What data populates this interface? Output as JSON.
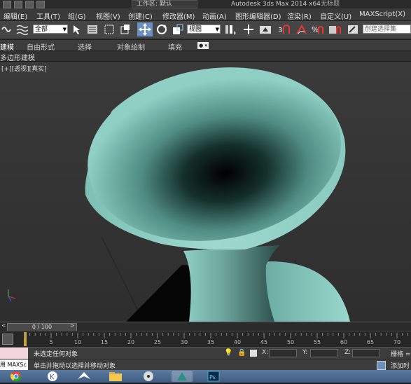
{
  "titlebar": {
    "workspace_label": "工作区: 默认",
    "app_title": "Autodesk 3ds Max  2014 x64",
    "doc_name": "无标题"
  },
  "menu": {
    "items": [
      {
        "label": "编辑(E)"
      },
      {
        "label": "工具(T)"
      },
      {
        "label": "组(G)"
      },
      {
        "label": "视图(V)"
      },
      {
        "label": "创建(C)"
      },
      {
        "label": "修改器(M)"
      },
      {
        "label": "动画(A)"
      },
      {
        "label": "图形编辑器(D)"
      },
      {
        "label": "渲染(R)"
      },
      {
        "label": "自定义(U)"
      },
      {
        "label": "MAXScript(X)"
      }
    ]
  },
  "toolbar": {
    "selection_filter": "全部",
    "ref_coord": "视图",
    "named_selection_placeholder": "创建选择集"
  },
  "ribbon": {
    "tabs": [
      {
        "label": "建模"
      },
      {
        "label": "自由形式"
      },
      {
        "label": "选择"
      },
      {
        "label": "对象绘制"
      },
      {
        "label": "填充"
      }
    ],
    "panel_label": "多边形建模"
  },
  "viewport": {
    "label": "[+][透视][真实]"
  },
  "timeline": {
    "position_label": "0 / 100",
    "ticks": [
      "5",
      "10",
      "15",
      "20",
      "25",
      "30",
      "35",
      "40",
      "45",
      "50",
      "55",
      "60",
      "65",
      "70"
    ]
  },
  "status": {
    "maxscript_label": "用 MAXSc",
    "selection_msg": "未选定任何对象",
    "prompt_msg": "单击并拖动以选择并移动对象",
    "x_label": "X:",
    "y_label": "Y:",
    "z_label": "Z:",
    "grid_label": "栅格 =",
    "add_time_tag": "添加时"
  },
  "colors": {
    "object_surface": "#8fcfc4",
    "viewport_bg": "#353535",
    "taskbar": "#4a6a93"
  }
}
